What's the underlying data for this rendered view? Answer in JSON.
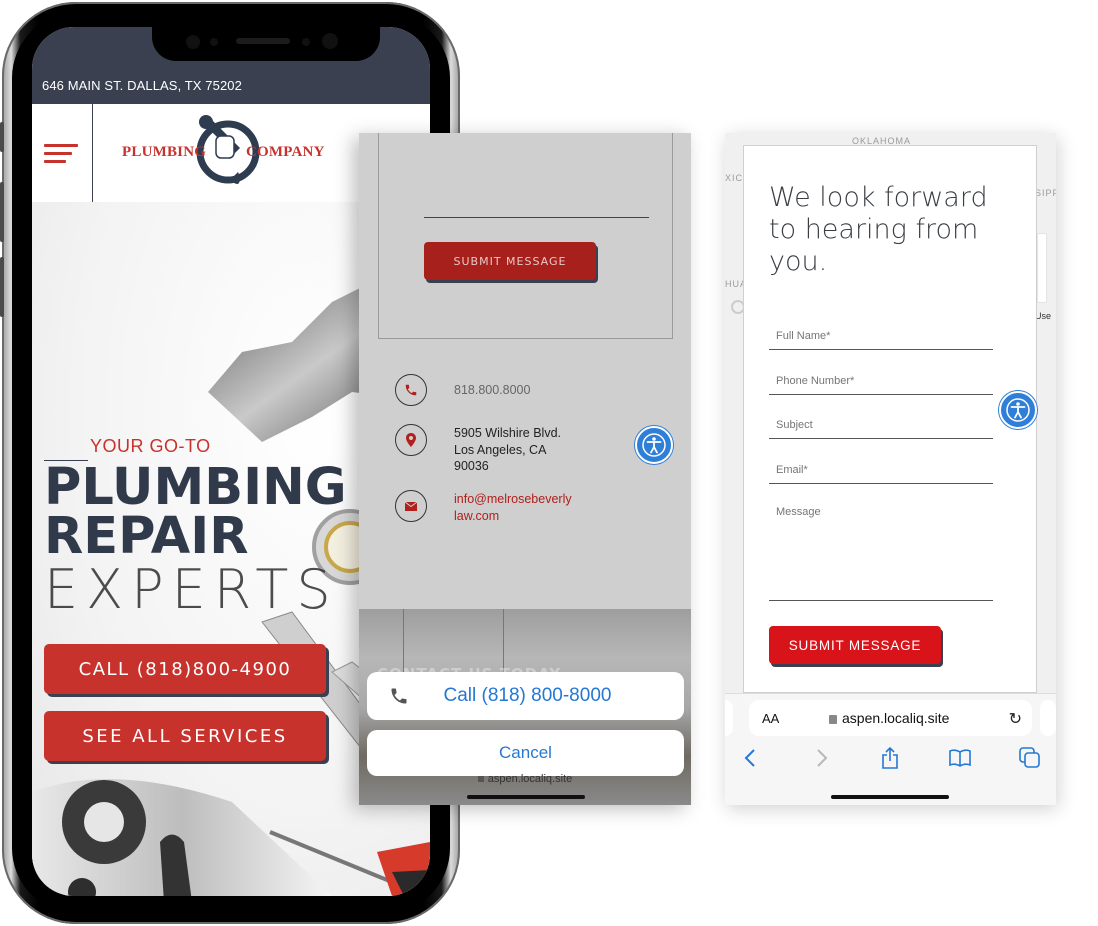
{
  "phone": {
    "topbar_address": "646 MAIN ST. DALLAS, TX 75202",
    "logo": {
      "left_word": "PLUMBING",
      "right_word": "COMPANY"
    },
    "hero": {
      "eyebrow": "YOUR GO-TO",
      "line1": "PLUMBING",
      "line2": "REPAIR",
      "line3": "EXPERTS",
      "call_button": "CALL (818)800-4900",
      "services_button": "SEE ALL SERVICES"
    }
  },
  "middle": {
    "submit_button": "SUBMIT MESSAGE",
    "contact": {
      "phone": "818.800.8000",
      "address_line1": "5905 Wilshire Blvd.",
      "address_line2": "Los Angeles, CA",
      "address_line3": "90036",
      "email_line1": "info@melrosebeverly",
      "email_line2": "law.com"
    },
    "obscured_heading": "CONTACT US TODAY",
    "action_sheet": {
      "call_label": "Call (818) 800-8000",
      "cancel_label": "Cancel"
    },
    "url": "aspen.localiq.site"
  },
  "right": {
    "map_labels": {
      "top": "OKLAHOMA",
      "left_top": "XICO",
      "left_bottom": "HUA",
      "right_top": "SIPP",
      "right_bottom": "Use"
    },
    "form": {
      "title": "We look forward to hearing from you.",
      "fields": [
        {
          "placeholder": "Full Name*"
        },
        {
          "placeholder": "Phone Number*"
        },
        {
          "placeholder": "Subject"
        },
        {
          "placeholder": "Email*"
        }
      ],
      "message_placeholder": "Message",
      "submit_button": "SUBMIT MESSAGE"
    },
    "safari": {
      "text_size_label": "AA",
      "url": "aspen.localiq.site"
    }
  },
  "colors": {
    "brand_red": "#c8322d",
    "brand_navy": "#3a4050",
    "submit_red": "#d8131a",
    "ios_blue": "#2478d4",
    "accessibility_blue": "#2f7fd8"
  }
}
